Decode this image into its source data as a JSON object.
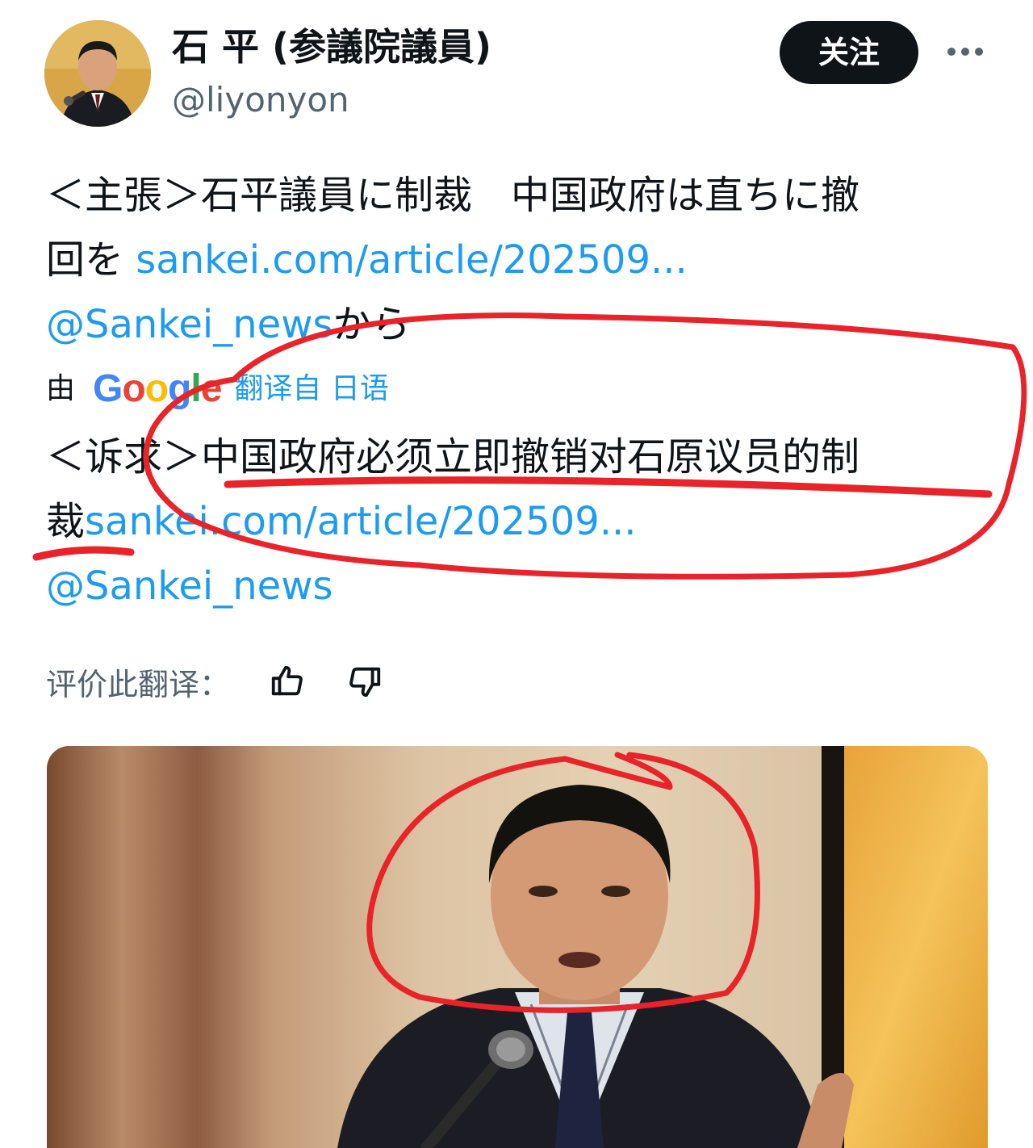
{
  "header": {
    "display_name": "石 平 (参議院議員)",
    "handle": "@liyonyon",
    "follow_label": "关注",
    "more_icon": "more-horizontal-icon"
  },
  "tweet": {
    "original_line1": "＜主張＞石平議員に制裁　中国政府は直ちに撤",
    "original_line2_text": "回を",
    "original_link": "sankei.com/article/202509...",
    "original_mention": "@Sankei_news",
    "original_suffix": "から",
    "translated_by_prefix": "由",
    "google_logo": [
      "G",
      "o",
      "o",
      "g",
      "l",
      "e"
    ],
    "translated_from": "翻译自 日语",
    "translation_line1": "＜诉求＞中国政府必须立即撤销对石原议员的制",
    "translation_line2_text": "裁",
    "translation_link": "sankei.com/article/202509...",
    "translation_mention": "@Sankei_news"
  },
  "rating": {
    "label": "评价此翻译：",
    "thumbs_up_icon": "thumbs-up-icon",
    "thumbs_down_icon": "thumbs-down-icon"
  },
  "colors": {
    "link": "#1d9bf0",
    "secondary_text": "#536471",
    "primary_text": "#0f1419",
    "annotation_red": "#e8232a"
  }
}
